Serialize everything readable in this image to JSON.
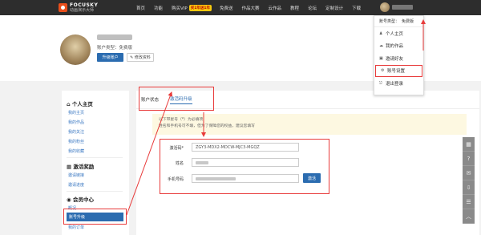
{
  "header": {
    "logo_title": "FOCUSKY",
    "logo_subtitle": "动画演示大师",
    "nav": [
      {
        "label": "首页"
      },
      {
        "label": "功能"
      },
      {
        "label": "购买VIP"
      },
      {
        "label": "免费送"
      },
      {
        "label": "作品大赛"
      },
      {
        "label": "云作品"
      },
      {
        "label": "教程"
      },
      {
        "label": "论坛"
      },
      {
        "label": "定制设计"
      },
      {
        "label": "下载"
      }
    ],
    "vip_badge": "买1年送1年"
  },
  "user_menu": {
    "account_type_label": "账号类型：",
    "account_type_value": "免费版",
    "items": [
      {
        "icon": "user-icon",
        "label": "个人主页"
      },
      {
        "icon": "cloud-icon",
        "label": "我的作品"
      },
      {
        "icon": "gift-icon",
        "label": "邀请好友"
      },
      {
        "icon": "gear-icon",
        "label": "账号设置"
      },
      {
        "icon": "logout-icon",
        "label": "退出登录"
      }
    ]
  },
  "profile": {
    "account_type": "账户类型：免费版",
    "upgrade_button": "升级账户",
    "edit_button": "修改资料"
  },
  "sidebar": {
    "sections": [
      {
        "title": "个人主页",
        "icon": "home-icon",
        "links": [
          "我的主页",
          "我的作品",
          "我的关注",
          "我的粉丝",
          "我的收藏"
        ]
      },
      {
        "title": "激活奖励",
        "icon": "code-icon",
        "links": [
          "邀请链接",
          "邀请进度"
        ]
      },
      {
        "title": "会员中心",
        "icon": "user-circle-icon",
        "links": [
          "概况",
          "账号升级",
          "我的订单"
        ]
      }
    ],
    "active_item": "账号升级"
  },
  "main": {
    "tabs": [
      {
        "label": "账户状态"
      },
      {
        "label": "激活码升级"
      }
    ],
    "notice_line1": "以下带星号（*）为必填项",
    "notice_line2": "姓名和手机号可不填，但为了保障您的权益，建议您填写",
    "form": {
      "code_label": "激活码*",
      "code_value": "ZGY3-MDX2-MDCW-MJC3-MGQZ",
      "name_label": "姓名",
      "phone_label": "手机号码",
      "activate_button": "激活"
    }
  },
  "right_toolbar": [
    "grid-icon",
    "question-icon",
    "chat-icon",
    "download-icon",
    "list-icon",
    "up-icon"
  ],
  "colors": {
    "accent": "#2b6cb0",
    "highlight": "#e83b3b",
    "topbar": "#2d2d2d",
    "link": "#3a78c2"
  }
}
